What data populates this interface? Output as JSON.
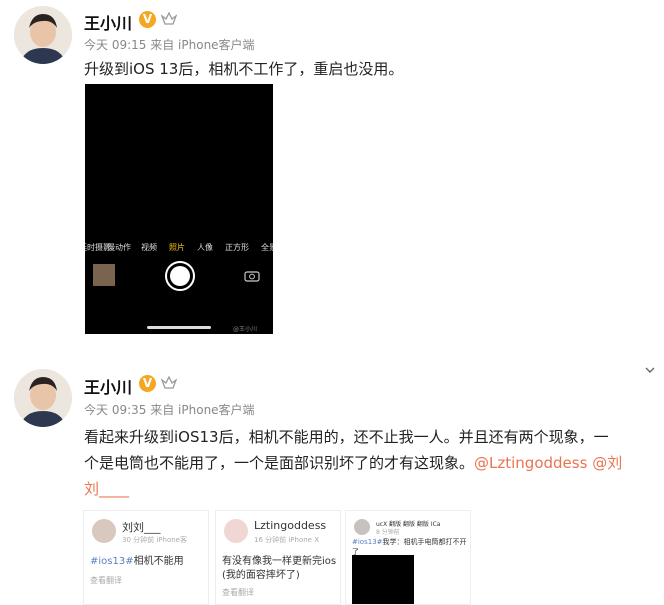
{
  "post1": {
    "user_name": "王小川",
    "verified_badge": "V",
    "time": "今天 09:15",
    "source": "来自 iPhone客户端",
    "content": "升级到iOS 13后，相机不工作了，重启也没用。",
    "camera": {
      "modes": [
        "延时摄影",
        "慢动作",
        "视频",
        "照片",
        "人像",
        "正方形",
        "全景"
      ],
      "active_mode": "照片",
      "watermark": "@王小川"
    }
  },
  "post2": {
    "user_name": "王小川",
    "verified_badge": "V",
    "time": "今天 09:35",
    "source": "来自 iPhone客户端",
    "content_line1": "看起来升级到iOS13后，相机不能用的，还不止我一人。并且还有两个现象，一",
    "content_line2_text": "个是电筒也不能用了，一个是面部识别坏了的才有这现象。",
    "mention1": "@Lztingoddess",
    "mention2_part1": "@刘",
    "mention2_part2": "刘____"
  },
  "cards": [
    {
      "name": "刘刘___",
      "meta": "30 分钟前  iPhone客",
      "hashtag": "#ios13#",
      "text": "相机不能用",
      "translate": "查看翻译"
    },
    {
      "name": "Lztingoddess",
      "meta": "16 分钟前  iPhone X",
      "text_line1": "有没有像我一样更新完ios",
      "text_line2": "(我的面容摔坏了)",
      "translate": "查看翻译"
    },
    {
      "name": "ucX 翻版 翻版 翻版 ICa",
      "meta": "8 分钟前",
      "hashtag": "#ios13#",
      "text": "我学：相机手电筒都打不开了"
    }
  ],
  "colors": {
    "mention": "#eb7350",
    "badge": "#f5a623",
    "active_mode": "#f5c518"
  }
}
